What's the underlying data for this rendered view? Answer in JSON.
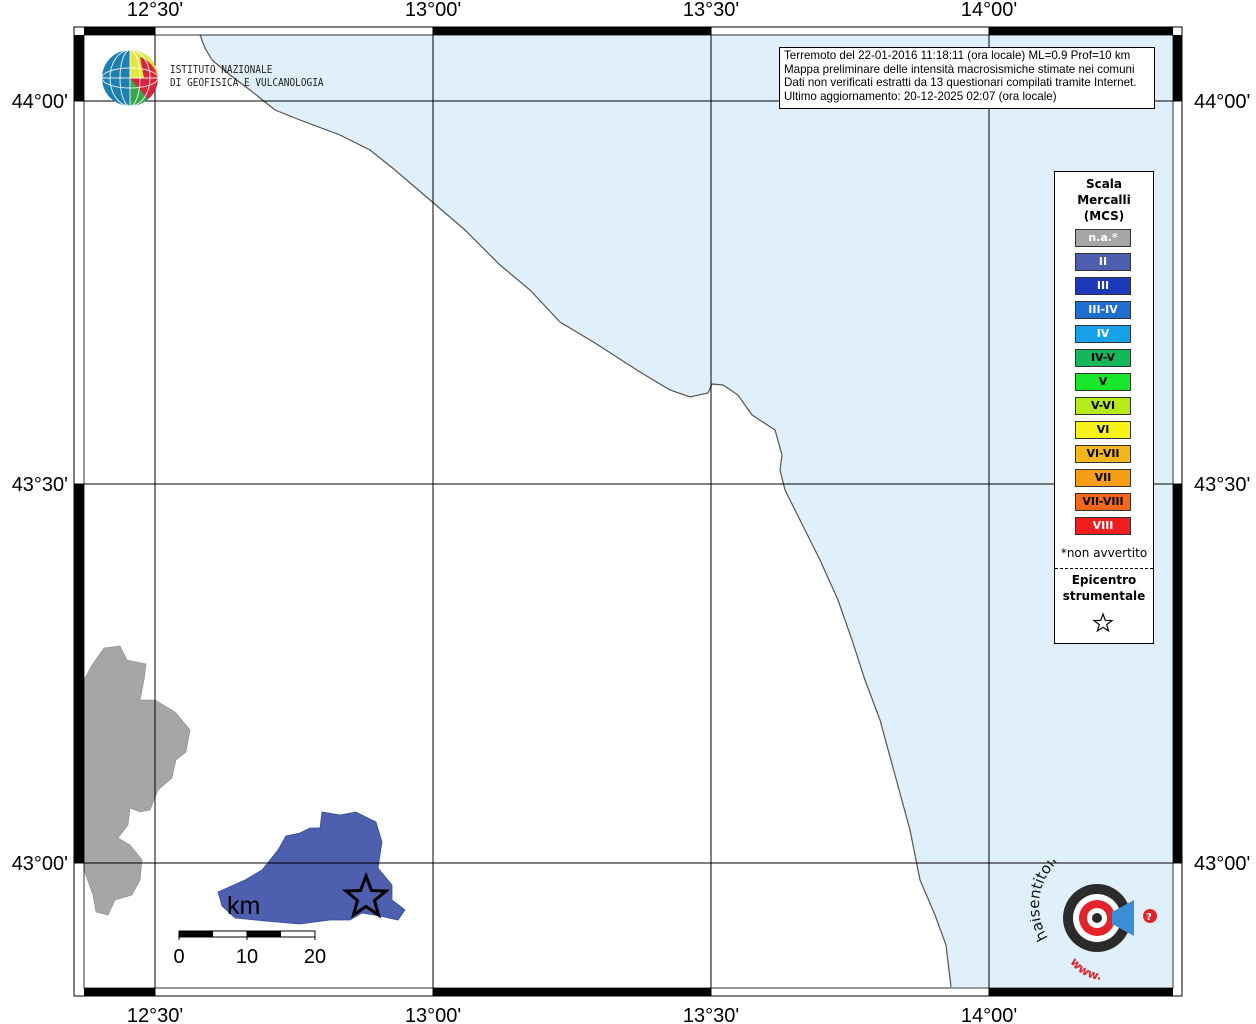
{
  "map": {
    "longitude_ticks": [
      "12°30'",
      "13°00'",
      "13°30'",
      "14°00'"
    ],
    "latitude_ticks": [
      "44°00'",
      "43°30'",
      "43°00'"
    ],
    "colors": {
      "sea": "#dff0fb",
      "land": "#ffffff",
      "not_felt_area": "#a6a6a6",
      "intensity_II_area": "#4d5fae",
      "coast": "#555555",
      "grid": "#000000"
    },
    "epicenter_icon": "star-outline-icon",
    "scale_bar": {
      "unit": "km",
      "labels": [
        "0",
        "10",
        "20"
      ]
    }
  },
  "logos": {
    "ingv_line1": "ISTITUTO NAZIONALE",
    "ingv_line2": "DI GEOFISICA E VULCANOLOGIA",
    "hsit_text": "haisentitoilterremoto.it",
    "hsit_www": "www."
  },
  "infobox": {
    "line1": "Terremoto del 22-01-2016 11:18:11 (ora locale) ML=0.9 Prof=10 km",
    "line2": "Mappa preliminare delle intensità macrosismiche stimate nei comuni",
    "line3": "Dati non verificati estratti da 13 questionari compilati tramite Internet.",
    "line4": "Ultimo aggiornamento: 20-12-2025 02:07 (ora locale)"
  },
  "legend": {
    "title_line1": "Scala",
    "title_line2": "Mercalli",
    "title_line3": "(MCS)",
    "classes": [
      {
        "label": "n.a.*",
        "color": "#a6a6a6",
        "text_color": "#ffffff"
      },
      {
        "label": "II",
        "color": "#4d5fae",
        "text_color": "#ffffff"
      },
      {
        "label": "III",
        "color": "#1b39b8",
        "text_color": "#ffffff"
      },
      {
        "label": "III-IV",
        "color": "#1e6fd0",
        "text_color": "#ffffff"
      },
      {
        "label": "IV",
        "color": "#15a2e8",
        "text_color": "#ffffff"
      },
      {
        "label": "IV-V",
        "color": "#14b85a",
        "text_color": "#000000"
      },
      {
        "label": "V",
        "color": "#17e62a",
        "text_color": "#000000"
      },
      {
        "label": "V-VI",
        "color": "#b6ea19",
        "text_color": "#000000"
      },
      {
        "label": "VI",
        "color": "#f7f319",
        "text_color": "#000000"
      },
      {
        "label": "VI-VII",
        "color": "#f6b71a",
        "text_color": "#000000"
      },
      {
        "label": "VII",
        "color": "#f79d14",
        "text_color": "#000000"
      },
      {
        "label": "VII-VIII",
        "color": "#f5661a",
        "text_color": "#000000"
      },
      {
        "label": "VIII",
        "color": "#ef1d1d",
        "text_color": "#ffffff"
      }
    ],
    "footnote": "*non avvertito",
    "epicenter_line1": "Epicentro",
    "epicenter_line2": "strumentale",
    "epicenter_icon": "star-outline-icon"
  }
}
